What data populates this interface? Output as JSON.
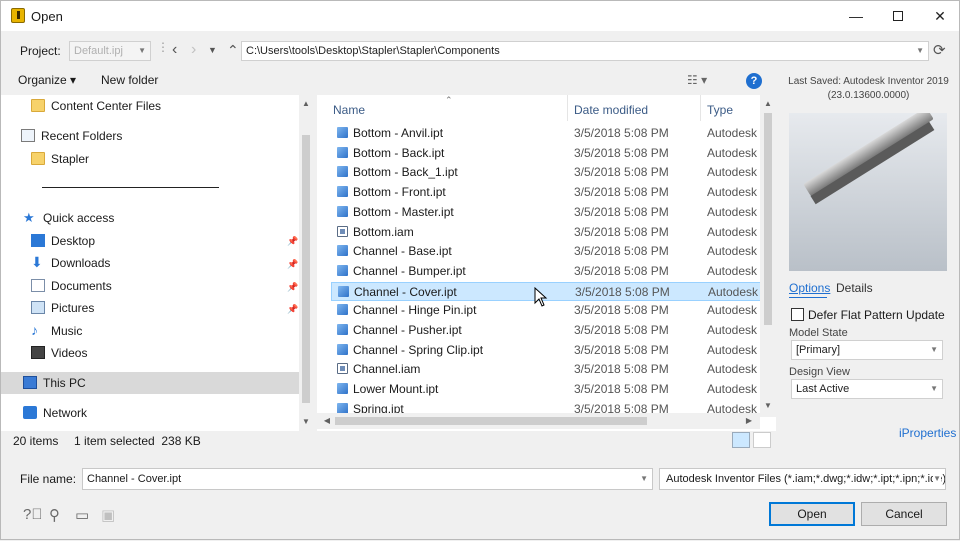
{
  "window": {
    "title": "Open"
  },
  "project": {
    "label": "Project:",
    "value": "Default.ipj",
    "path": "C:\\Users\\tools\\Desktop\\Stapler\\Stapler\\Components"
  },
  "toolbar": {
    "organize": "Organize",
    "new_folder": "New folder",
    "help": "?"
  },
  "nav": {
    "content_center": "Content Center Files",
    "recent_folders": "Recent Folders",
    "stapler": "Stapler",
    "quick_access": "Quick access",
    "items": [
      "Desktop",
      "Downloads",
      "Documents",
      "Pictures",
      "Music",
      "Videos"
    ],
    "this_pc": "This PC",
    "network": "Network"
  },
  "columns": {
    "name": "Name",
    "date": "Date modified",
    "type": "Type"
  },
  "files": [
    {
      "name": "Bottom - Anvil.ipt",
      "date": "3/5/2018 5:08 PM",
      "type": "Autodesk I",
      "icon": "ipt"
    },
    {
      "name": "Bottom - Back.ipt",
      "date": "3/5/2018 5:08 PM",
      "type": "Autodesk I",
      "icon": "ipt"
    },
    {
      "name": "Bottom - Back_1.ipt",
      "date": "3/5/2018 5:08 PM",
      "type": "Autodesk I",
      "icon": "ipt"
    },
    {
      "name": "Bottom - Front.ipt",
      "date": "3/5/2018 5:08 PM",
      "type": "Autodesk I",
      "icon": "ipt"
    },
    {
      "name": "Bottom - Master.ipt",
      "date": "3/5/2018 5:08 PM",
      "type": "Autodesk I",
      "icon": "ipt"
    },
    {
      "name": "Bottom.iam",
      "date": "3/5/2018 5:08 PM",
      "type": "Autodesk I",
      "icon": "iam"
    },
    {
      "name": "Channel - Base.ipt",
      "date": "3/5/2018 5:08 PM",
      "type": "Autodesk I",
      "icon": "ipt"
    },
    {
      "name": "Channel - Bumper.ipt",
      "date": "3/5/2018 5:08 PM",
      "type": "Autodesk I",
      "icon": "ipt"
    },
    {
      "name": "Channel - Cover.ipt",
      "date": "3/5/2018 5:08 PM",
      "type": "Autodesk I",
      "icon": "ipt"
    },
    {
      "name": "Channel - Hinge Pin.ipt",
      "date": "3/5/2018 5:08 PM",
      "type": "Autodesk I",
      "icon": "ipt"
    },
    {
      "name": "Channel - Pusher.ipt",
      "date": "3/5/2018 5:08 PM",
      "type": "Autodesk I",
      "icon": "ipt"
    },
    {
      "name": "Channel - Spring Clip.ipt",
      "date": "3/5/2018 5:08 PM",
      "type": "Autodesk I",
      "icon": "ipt"
    },
    {
      "name": "Channel.iam",
      "date": "3/5/2018 5:08 PM",
      "type": "Autodesk I",
      "icon": "iam"
    },
    {
      "name": "Lower Mount.ipt",
      "date": "3/5/2018 5:08 PM",
      "type": "Autodesk I",
      "icon": "ipt"
    },
    {
      "name": "Spring.ipt",
      "date": "3/5/2018 5:08 PM",
      "type": "Autodesk I",
      "icon": "ipt"
    }
  ],
  "status": {
    "count": "20 items",
    "selected": "1 item selected  238 KB"
  },
  "preview": {
    "last_saved": "Last Saved: Autodesk Inventor 2019",
    "version": "(23.0.13600.0000)",
    "tab_options": "Options",
    "tab_details": "Details",
    "defer_label": "Defer Flat Pattern Update",
    "model_state_label": "Model State",
    "model_state_value": "[Primary]",
    "design_view_label": "Design View",
    "design_view_value": "Last Active",
    "iproperties": "iProperties"
  },
  "bottom": {
    "file_name_label": "File name:",
    "file_name_value": "Channel - Cover.ipt",
    "file_type": "Autodesk Inventor Files (*.iam;*.dwg;*.idw;*.ipt;*.ipn;*.ide)",
    "open": "Open",
    "cancel": "Cancel"
  }
}
